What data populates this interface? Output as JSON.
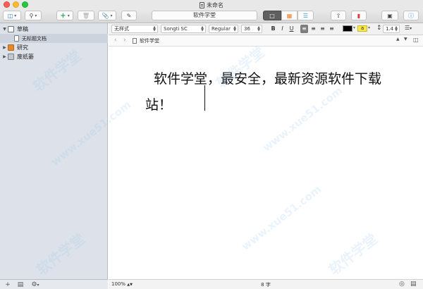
{
  "window": {
    "title": "未命名"
  },
  "toolbar": {
    "binder_toggle_icon": "sidebar-toggle-icon",
    "search_icon": "search-icon",
    "add_icon": "plus-icon",
    "trash_icon": "trash-icon",
    "attach_icon": "paperclip-icon",
    "compose_icon": "compose-icon",
    "document_title": "软件学堂",
    "view_modes": [
      "single-document-view",
      "corkboard-view",
      "outliner-view"
    ],
    "share_icon": "share-icon",
    "bookmark_icon": "bookmark-icon",
    "quick_reference_icon": "quick-reference-icon",
    "inspector_icon": "info-icon"
  },
  "binder": {
    "items": [
      {
        "label": "草稿",
        "expanded": true,
        "icon": "draft-folder-icon"
      },
      {
        "label": "无标题文档",
        "icon": "document-icon"
      },
      {
        "label": "研究",
        "expanded": false,
        "icon": "research-folder-icon"
      },
      {
        "label": "废纸篓",
        "expanded": false,
        "icon": "trash-folder-icon"
      }
    ],
    "footer": [
      "add-icon",
      "new-folder-icon",
      "gear-icon"
    ]
  },
  "format_bar": {
    "paragraph_style": "无样式",
    "font_family": "Songti SC",
    "font_weight": "Regular",
    "font_size": "36",
    "bold": "B",
    "italic": "I",
    "underline": "U",
    "text_color": "#000000",
    "highlight_label": "a",
    "highlight_color": "#f7e94a",
    "line_spacing": "1.4"
  },
  "header": {
    "path_label": "软件学堂"
  },
  "editor": {
    "text": "软件学堂，最安全，最新资源软件下载站！"
  },
  "footer": {
    "zoom": "100%",
    "word_count": "8 字"
  },
  "watermark": {
    "text": "软件学堂",
    "url": "www.xue51.com"
  }
}
